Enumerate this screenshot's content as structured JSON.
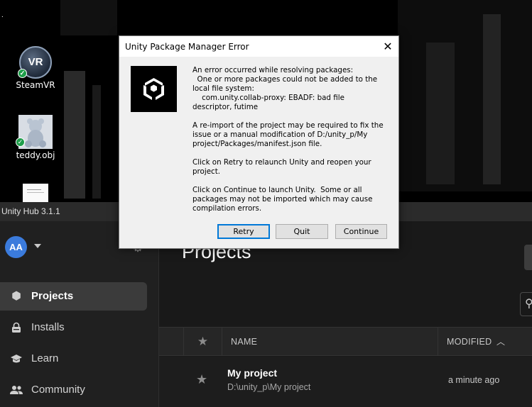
{
  "desktop": {
    "icons": [
      {
        "label": "SteamVR",
        "badge": "VR"
      },
      {
        "label": "teddy.obj"
      }
    ]
  },
  "hub": {
    "window_title": "Unity Hub 3.1.1",
    "avatar_initials": "AA",
    "nav": [
      {
        "label": "Projects",
        "icon": "cube-icon",
        "active": true
      },
      {
        "label": "Installs",
        "icon": "lock-icon"
      },
      {
        "label": "Learn",
        "icon": "graduation-cap-icon"
      },
      {
        "label": "Community",
        "icon": "people-icon"
      }
    ],
    "page_title": "Projects",
    "table": {
      "columns": [
        "NAME",
        "MODIFIED"
      ],
      "rows": [
        {
          "name": "My project",
          "path": "D:\\unity_p\\My project",
          "modified": "a minute ago"
        }
      ]
    }
  },
  "dialog": {
    "title": "Unity Package Manager Error",
    "message": "An error occurred while resolving packages:\n  One or more packages could not be added to the local file system:\n    com.unity.collab-proxy: EBADF: bad file descriptor, futime\n\nA re-import of the project may be required to fix the issue or a manual modification of D:/unity_p/My project/Packages/manifest.json file.\n\nClick on Retry to relaunch Unity and reopen your project.\n\nClick on Continue to launch Unity.  Some or all packages may not be imported which may cause compilation errors.",
    "buttons": {
      "retry": "Retry",
      "quit": "Quit",
      "continue": "Continue"
    },
    "close_glyph": "✕"
  },
  "colors": {
    "accent_blue": "#0078d7",
    "avatar_blue": "#3b7bdc",
    "hub_bg": "#191919"
  }
}
